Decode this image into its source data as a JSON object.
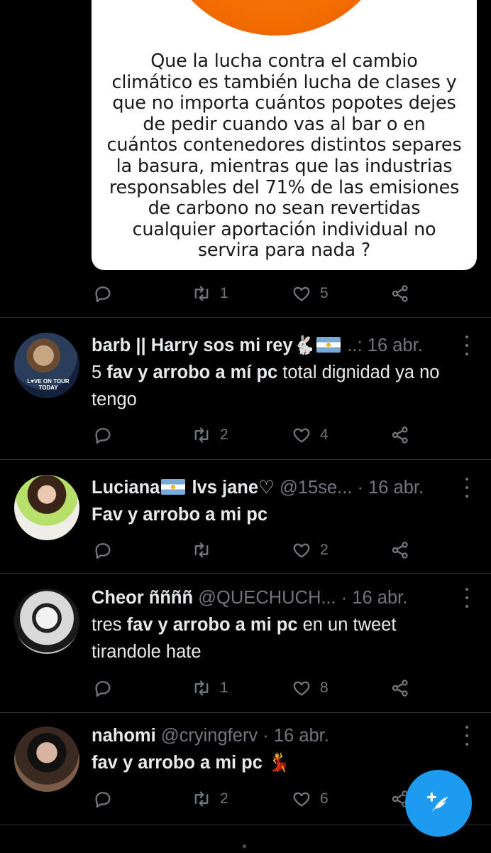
{
  "image_card": {
    "lines": [
      "Que la lucha contra el cambio",
      "climático es también lucha de clases y",
      "que no importa cuántos popotes dejes",
      "de pedir cuando vas al bar o en",
      "cuántos contenedores distintos separes",
      "la basura, mientras que las industrias",
      "responsables del 71% de las emisiones",
      "de carbono no sean revertidas",
      "cualquier aportación individual no",
      "servira para nada ?"
    ]
  },
  "top_actions": {
    "retweets": "1",
    "likes": "5"
  },
  "tweets": [
    {
      "name": "barb || Harry sos mi rey",
      "name_emoji": "🐇",
      "handle": "..:",
      "dot": "",
      "date": "16 abr.",
      "body_plain_1": "5 ",
      "body_bold": "fav y arrobo a mí pc",
      "body_plain_2": " total dignidad ya no tengo",
      "retweets": "2",
      "likes": "4",
      "avatar_text_1": "L♥VE ON TOUR",
      "avatar_text_2": "TODAY"
    },
    {
      "name": "Luciana",
      "name_suffix": " lvs jane♡",
      "handle": "@15se...",
      "dot": "·",
      "date": "16 abr.",
      "body_bold": "Fav y arrobo a mi pc",
      "retweets": "",
      "likes": "2"
    },
    {
      "name": "Cheor ññññ",
      "handle": "@QUECHUCH...",
      "dot": "·",
      "date": "16 abr.",
      "body_plain_1": "tres ",
      "body_bold": "fav y arrobo a mi pc",
      "body_plain_2": " en un tweet tirandole hate",
      "retweets": "1",
      "likes": "8"
    },
    {
      "name": "nahomi",
      "handle": "@cryingferv",
      "dot": "·",
      "date": "16 abr.",
      "body_bold": "fav y arrobo a mi pc",
      "body_emoji": "💃",
      "retweets": "2",
      "likes": "6"
    }
  ],
  "colors": {
    "accent": "#1d9bf0",
    "muted": "#71767b",
    "divider": "#2f3336"
  },
  "icons": [
    "reply-icon",
    "retweet-icon",
    "like-icon",
    "share-icon",
    "more-icon",
    "compose-icon"
  ]
}
